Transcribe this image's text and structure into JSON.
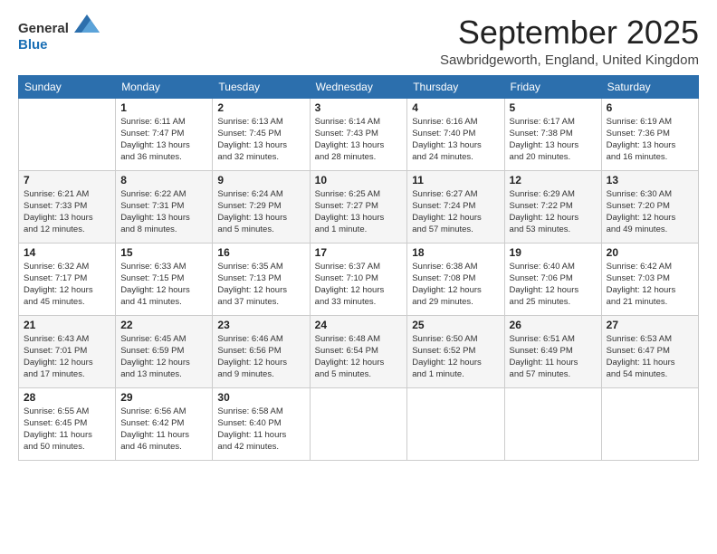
{
  "logo": {
    "general": "General",
    "blue": "Blue"
  },
  "header": {
    "month": "September 2025",
    "location": "Sawbridgeworth, England, United Kingdom"
  },
  "days_of_week": [
    "Sunday",
    "Monday",
    "Tuesday",
    "Wednesday",
    "Thursday",
    "Friday",
    "Saturday"
  ],
  "weeks": [
    [
      {
        "day": "",
        "info": ""
      },
      {
        "day": "1",
        "info": "Sunrise: 6:11 AM\nSunset: 7:47 PM\nDaylight: 13 hours\nand 36 minutes."
      },
      {
        "day": "2",
        "info": "Sunrise: 6:13 AM\nSunset: 7:45 PM\nDaylight: 13 hours\nand 32 minutes."
      },
      {
        "day": "3",
        "info": "Sunrise: 6:14 AM\nSunset: 7:43 PM\nDaylight: 13 hours\nand 28 minutes."
      },
      {
        "day": "4",
        "info": "Sunrise: 6:16 AM\nSunset: 7:40 PM\nDaylight: 13 hours\nand 24 minutes."
      },
      {
        "day": "5",
        "info": "Sunrise: 6:17 AM\nSunset: 7:38 PM\nDaylight: 13 hours\nand 20 minutes."
      },
      {
        "day": "6",
        "info": "Sunrise: 6:19 AM\nSunset: 7:36 PM\nDaylight: 13 hours\nand 16 minutes."
      }
    ],
    [
      {
        "day": "7",
        "info": "Sunrise: 6:21 AM\nSunset: 7:33 PM\nDaylight: 13 hours\nand 12 minutes."
      },
      {
        "day": "8",
        "info": "Sunrise: 6:22 AM\nSunset: 7:31 PM\nDaylight: 13 hours\nand 8 minutes."
      },
      {
        "day": "9",
        "info": "Sunrise: 6:24 AM\nSunset: 7:29 PM\nDaylight: 13 hours\nand 5 minutes."
      },
      {
        "day": "10",
        "info": "Sunrise: 6:25 AM\nSunset: 7:27 PM\nDaylight: 13 hours\nand 1 minute."
      },
      {
        "day": "11",
        "info": "Sunrise: 6:27 AM\nSunset: 7:24 PM\nDaylight: 12 hours\nand 57 minutes."
      },
      {
        "day": "12",
        "info": "Sunrise: 6:29 AM\nSunset: 7:22 PM\nDaylight: 12 hours\nand 53 minutes."
      },
      {
        "day": "13",
        "info": "Sunrise: 6:30 AM\nSunset: 7:20 PM\nDaylight: 12 hours\nand 49 minutes."
      }
    ],
    [
      {
        "day": "14",
        "info": "Sunrise: 6:32 AM\nSunset: 7:17 PM\nDaylight: 12 hours\nand 45 minutes."
      },
      {
        "day": "15",
        "info": "Sunrise: 6:33 AM\nSunset: 7:15 PM\nDaylight: 12 hours\nand 41 minutes."
      },
      {
        "day": "16",
        "info": "Sunrise: 6:35 AM\nSunset: 7:13 PM\nDaylight: 12 hours\nand 37 minutes."
      },
      {
        "day": "17",
        "info": "Sunrise: 6:37 AM\nSunset: 7:10 PM\nDaylight: 12 hours\nand 33 minutes."
      },
      {
        "day": "18",
        "info": "Sunrise: 6:38 AM\nSunset: 7:08 PM\nDaylight: 12 hours\nand 29 minutes."
      },
      {
        "day": "19",
        "info": "Sunrise: 6:40 AM\nSunset: 7:06 PM\nDaylight: 12 hours\nand 25 minutes."
      },
      {
        "day": "20",
        "info": "Sunrise: 6:42 AM\nSunset: 7:03 PM\nDaylight: 12 hours\nand 21 minutes."
      }
    ],
    [
      {
        "day": "21",
        "info": "Sunrise: 6:43 AM\nSunset: 7:01 PM\nDaylight: 12 hours\nand 17 minutes."
      },
      {
        "day": "22",
        "info": "Sunrise: 6:45 AM\nSunset: 6:59 PM\nDaylight: 12 hours\nand 13 minutes."
      },
      {
        "day": "23",
        "info": "Sunrise: 6:46 AM\nSunset: 6:56 PM\nDaylight: 12 hours\nand 9 minutes."
      },
      {
        "day": "24",
        "info": "Sunrise: 6:48 AM\nSunset: 6:54 PM\nDaylight: 12 hours\nand 5 minutes."
      },
      {
        "day": "25",
        "info": "Sunrise: 6:50 AM\nSunset: 6:52 PM\nDaylight: 12 hours\nand 1 minute."
      },
      {
        "day": "26",
        "info": "Sunrise: 6:51 AM\nSunset: 6:49 PM\nDaylight: 11 hours\nand 57 minutes."
      },
      {
        "day": "27",
        "info": "Sunrise: 6:53 AM\nSunset: 6:47 PM\nDaylight: 11 hours\nand 54 minutes."
      }
    ],
    [
      {
        "day": "28",
        "info": "Sunrise: 6:55 AM\nSunset: 6:45 PM\nDaylight: 11 hours\nand 50 minutes."
      },
      {
        "day": "29",
        "info": "Sunrise: 6:56 AM\nSunset: 6:42 PM\nDaylight: 11 hours\nand 46 minutes."
      },
      {
        "day": "30",
        "info": "Sunrise: 6:58 AM\nSunset: 6:40 PM\nDaylight: 11 hours\nand 42 minutes."
      },
      {
        "day": "",
        "info": ""
      },
      {
        "day": "",
        "info": ""
      },
      {
        "day": "",
        "info": ""
      },
      {
        "day": "",
        "info": ""
      }
    ]
  ]
}
